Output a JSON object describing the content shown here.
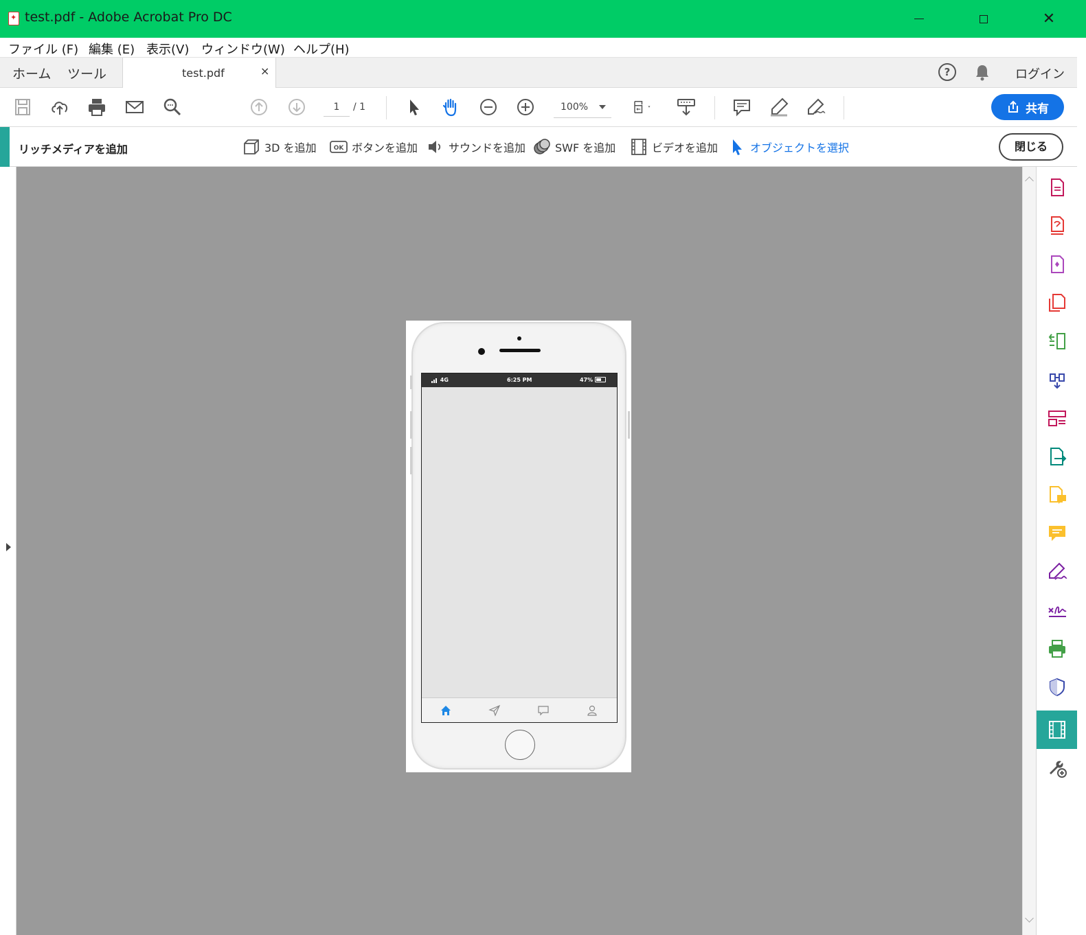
{
  "window": {
    "title": "test.pdf - Adobe Acrobat Pro DC",
    "controls": {
      "minimize": "—",
      "maximize": "☐",
      "close": "✕"
    }
  },
  "menu": [
    "ファイル (F)",
    "編集 (E)",
    "表示(V)",
    "ウィンドウ(W)",
    "ヘルプ(H)"
  ],
  "tabs": {
    "home": "ホーム",
    "tools": "ツール",
    "document": "test.pdf",
    "close": "×",
    "help": "?",
    "login": "ログイン"
  },
  "toolbar": {
    "page_current": "1",
    "page_total": "/ 1",
    "zoom": "100%",
    "share": "共有"
  },
  "richmedia": {
    "title": "リッチメディアを追加",
    "items": [
      "3D を追加",
      "ボタンを追加",
      "サウンドを追加",
      "SWF を追加",
      "ビデオを追加",
      "オブジェクトを選択"
    ],
    "close": "閉じる"
  },
  "phone": {
    "signal": "4G",
    "time": "6:25 PM",
    "battery": "47%"
  },
  "colors": {
    "titlebar": "#00cc66",
    "accent_blue": "#1473e6",
    "teal": "#26a69a",
    "viewer_bg": "#9a9a9a"
  }
}
